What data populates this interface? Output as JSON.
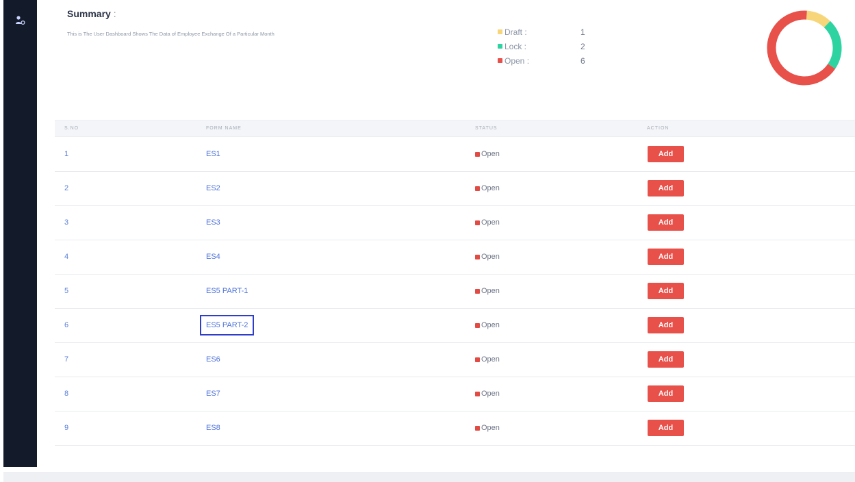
{
  "summary": {
    "title": "Summary",
    "colon": ":",
    "description": "This is The User Dashboard Shows The Data of Employee Exchange Of a Particular Month"
  },
  "legend": [
    {
      "label": "Draft :",
      "value": "1",
      "color": "#f7d67a"
    },
    {
      "label": "Lock :",
      "value": "2",
      "color": "#2ed3a2"
    },
    {
      "label": "Open :",
      "value": "6",
      "color": "#e8504a"
    }
  ],
  "donut_chart": {
    "type": "pie",
    "style": "donut",
    "categories": [
      "Draft",
      "Lock",
      "Open"
    ],
    "values": [
      1,
      2,
      6
    ],
    "colors": [
      "#f7d67a",
      "#2ed3a2",
      "#e8504a"
    ]
  },
  "table": {
    "columns": [
      "S.NO",
      "FORM NAME",
      "STATUS",
      "ACTION"
    ],
    "rows": [
      {
        "sno": "1",
        "form_name": "ES1",
        "status": "Open",
        "action": "Add"
      },
      {
        "sno": "2",
        "form_name": "ES2",
        "status": "Open",
        "action": "Add"
      },
      {
        "sno": "3",
        "form_name": "ES3",
        "status": "Open",
        "action": "Add"
      },
      {
        "sno": "4",
        "form_name": "ES4",
        "status": "Open",
        "action": "Add"
      },
      {
        "sno": "5",
        "form_name": "ES5 PART-1",
        "status": "Open",
        "action": "Add"
      },
      {
        "sno": "6",
        "form_name": "ES5 PART-2",
        "status": "Open",
        "action": "Add"
      },
      {
        "sno": "7",
        "form_name": "ES6",
        "status": "Open",
        "action": "Add"
      },
      {
        "sno": "8",
        "form_name": "ES7",
        "status": "Open",
        "action": "Add"
      },
      {
        "sno": "9",
        "form_name": "ES8",
        "status": "Open",
        "action": "Add"
      }
    ],
    "highlighted_row": 5
  },
  "icons": {
    "sidebar_user": "user-settings-icon"
  }
}
